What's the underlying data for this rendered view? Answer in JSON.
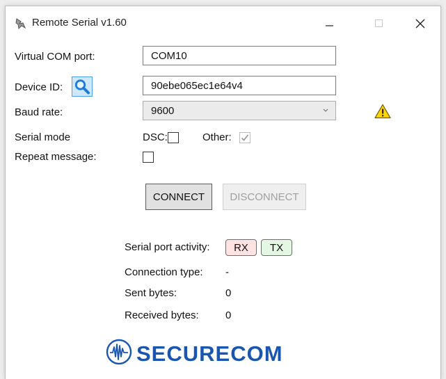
{
  "window": {
    "title": "Remote Serial v1.60"
  },
  "titlebar_buttons": {
    "minimize_icon": "minimize-icon",
    "maximize_icon": "maximize-icon",
    "close_icon": "close-icon"
  },
  "form": {
    "virtual_com_label": "Virtual COM port:",
    "virtual_com_value": "COM10",
    "device_id_label": "Device ID:",
    "device_id_value": "90ebe065ec1e64v4",
    "baud_rate_label": "Baud rate:",
    "baud_rate_value": "9600",
    "serial_mode_label": "Serial mode",
    "dsc_label": "DSC:",
    "dsc_checked": false,
    "other_label": "Other:",
    "other_checked": true,
    "other_disabled": true,
    "repeat_label": "Repeat message:",
    "repeat_checked": false
  },
  "buttons": {
    "connect_label": "CONNECT",
    "disconnect_label": "DISCONNECT"
  },
  "status": {
    "activity_label": "Serial port activity:",
    "rx_label": "RX",
    "tx_label": "TX",
    "connection_type_label": "Connection type:",
    "connection_type_value": "-",
    "sent_label": "Sent bytes:",
    "sent_value": "0",
    "received_label": "Received bytes:",
    "received_value": "0"
  },
  "logo": {
    "text": "SECURECOM"
  },
  "colors": {
    "accent": "#1a56b0",
    "warning": "#f5c400",
    "rx_bg": "#ffe3e3",
    "tx_bg": "#e3f7e3"
  }
}
